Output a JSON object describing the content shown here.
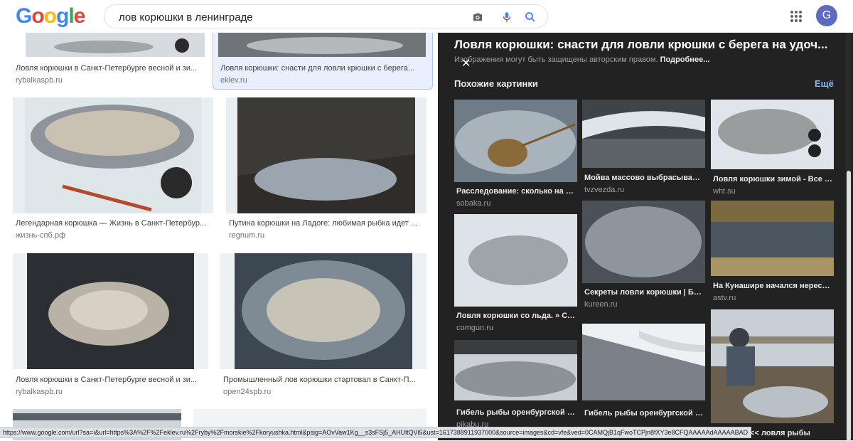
{
  "header": {
    "logo_letters": [
      "G",
      "o",
      "o",
      "g",
      "l",
      "e"
    ],
    "logo_colors": [
      "#4285f4",
      "#ea4335",
      "#fbbc05",
      "#4285f4",
      "#34a853",
      "#ea4335"
    ],
    "query": "лов корюшки в ленинграде",
    "camera_icon": "camera-icon",
    "mic_icon": "microphone-icon",
    "search_icon": "search-icon",
    "apps_icon": "apps-grid-icon",
    "avatar_letter": "G"
  },
  "results": [
    {
      "caption": "Ловля корюшки в Санкт-Петербурге весной и зи...",
      "source": "rybalkaspb.ru"
    },
    {
      "caption": "Ловля корюшки: снасти для ловли крюшки с берега...",
      "source": "eklev.ru"
    },
    {
      "caption": "Легендарная корюшка — Жизнь в Санкт-Петербур...",
      "source": "жизнь-спб.рф"
    },
    {
      "caption": "Путина корюшки на Ладоге: любимая рыбка идет ...",
      "source": "regnum.ru"
    },
    {
      "caption": "Ловля корюшки в Санкт-Петербурге весной и зи...",
      "source": "rybalkaspb.ru"
    },
    {
      "caption": "Промышленный лов корюшки стартовал в Санкт-П...",
      "source": "open24spb.ru"
    }
  ],
  "panel": {
    "title": "Ловля корюшки: снасти для ловли крюшки с берега на удоч...",
    "copyright": "Изображения могут быть защищены авторским правом.",
    "copyright_link": "Подробнее...",
    "close_icon": "close-icon",
    "similar_heading": "Похожие картинки",
    "more_link": "Ещё",
    "similar": [
      {
        "caption": "Расследование: сколько на с...",
        "source": "sobaka.ru"
      },
      {
        "caption": "Мойва массово выбрасывает...",
        "source": "tvzvezda.ru"
      },
      {
        "caption": "Ловля корюшки зимой - Все п...",
        "source": "wht.su"
      },
      {
        "caption": "Ловля корюшки со льда. » СО...",
        "source": "comgun.ru"
      },
      {
        "caption": "Секреты ловли корюшки | Ба...",
        "source": "kureen.ru"
      },
      {
        "caption": "На Кунашире начался нерест ...",
        "source": "astv.ru"
      },
      {
        "caption": "Гибель рыбы оренбургской о...",
        "source": "pikabu.ru"
      },
      {
        "caption": "Гибель рыбы оренбургской о...",
        "source": ""
      },
      {
        "caption": "корюшка << ловля рыбы",
        "source": ""
      }
    ]
  },
  "status_url": "https://www.google.com/url?sa=i&url=https%3A%2F%2Feklev.ru%2Fryby%2Fmorskie%2Fkoryushka.html&psig=AOvVaw1Kg__s3sFSj5_AHUltQVi5&ust=1617388911937000&source=images&cd=vfe&ved=0CAMQjB1qFwoTCPjn8fXY3e8CFQAAAAAdAAAAABAD"
}
